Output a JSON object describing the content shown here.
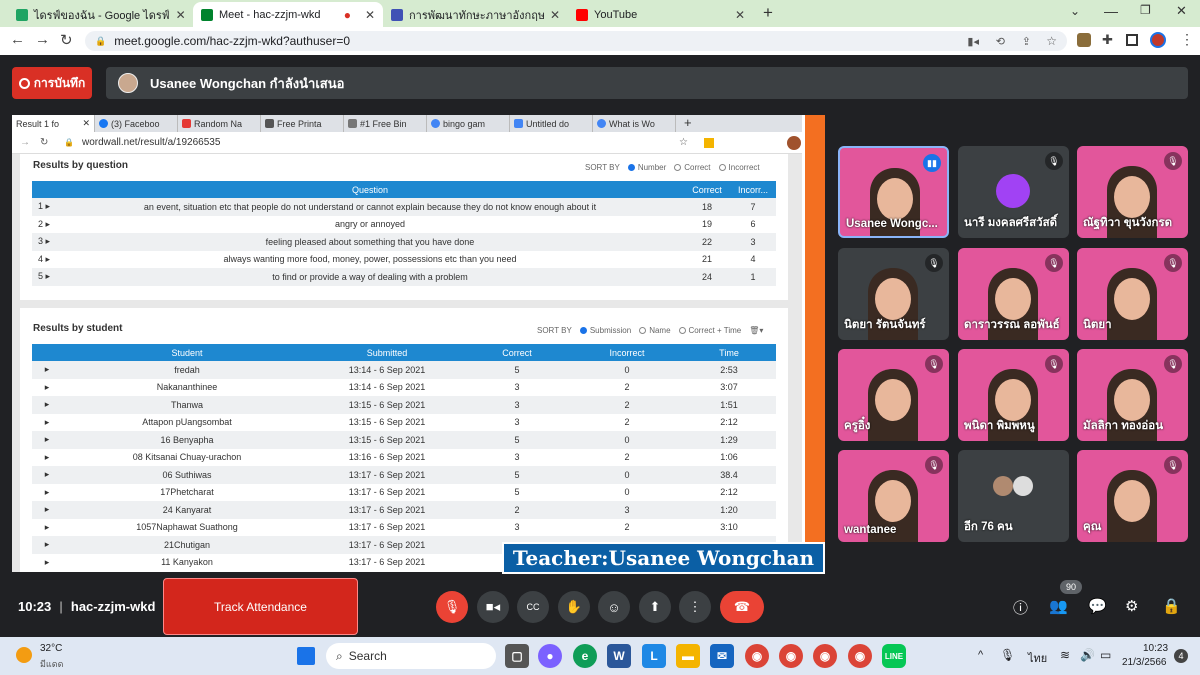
{
  "browser_tabs": [
    {
      "label": "ไดรฟ์ของฉัน - Google ไดรฟ์",
      "color": "#1fa463"
    },
    {
      "label": "Meet - hac-zzjm-wkd",
      "color": "#00832d"
    },
    {
      "label": "การพัฒนาทักษะภาษาอังกฤษ English",
      "color": "#3f51b5"
    },
    {
      "label": "YouTube",
      "color": "#ff0000"
    }
  ],
  "url": "meet.google.com/hac-zzjm-wkd?authuser=0",
  "meet": {
    "record_label": "การบันทึก",
    "presenter_text": "Usanee Wongchan กำลังนำเสนอ",
    "time": "10:23",
    "meeting_code": "hac-zzjm-wkd",
    "track_attendance": "Track Attendance",
    "people_count": "90"
  },
  "inner_browser": {
    "tabs": [
      "Result 1 fo",
      "(3) Faceboo",
      "Random Na",
      "Free Printa",
      "#1 Free Bin",
      "bingo gam",
      "Untitled do",
      "What is Wo"
    ],
    "url": "wordwall.net/result/a/19266535"
  },
  "results_by_question": {
    "title": "Results by question",
    "sort_by": "SORT BY",
    "sort_options": [
      "Number",
      "Correct",
      "Incorrect"
    ],
    "headers": [
      "Question",
      "Correct",
      "Incorr..."
    ],
    "rows": [
      {
        "num": "1",
        "question": "an event, situation etc that people do not understand or cannot explain because they do not know enough about it",
        "correct": "18",
        "incorrect": "7"
      },
      {
        "num": "2",
        "question": "angry or annoyed",
        "correct": "19",
        "incorrect": "6"
      },
      {
        "num": "3",
        "question": "feeling pleased about something that you have done",
        "correct": "22",
        "incorrect": "3"
      },
      {
        "num": "4",
        "question": "always wanting more food, money, power, possessions etc than you need",
        "correct": "21",
        "incorrect": "4"
      },
      {
        "num": "5",
        "question": "to find or provide a way of dealing with a problem",
        "correct": "24",
        "incorrect": "1"
      }
    ]
  },
  "results_by_student": {
    "title": "Results by student",
    "sort_by": "SORT BY",
    "sort_options": [
      "Submission",
      "Name",
      "Correct + Time"
    ],
    "headers": [
      "Student",
      "Submitted",
      "Correct",
      "Incorrect",
      "Time"
    ],
    "rows": [
      {
        "student": "fredah",
        "submitted": "13:14 - 6 Sep 2021",
        "correct": "5",
        "incorrect": "0",
        "time": "2:53"
      },
      {
        "student": "Nakananthinee",
        "submitted": "13:14 - 6 Sep 2021",
        "correct": "3",
        "incorrect": "2",
        "time": "3:07"
      },
      {
        "student": "Thanwa",
        "submitted": "13:15 - 6 Sep 2021",
        "correct": "3",
        "incorrect": "2",
        "time": "1:51"
      },
      {
        "student": "Attapon pUangsombat",
        "submitted": "13:15 - 6 Sep 2021",
        "correct": "3",
        "incorrect": "2",
        "time": "2:12"
      },
      {
        "student": "16 Benyapha",
        "submitted": "13:15 - 6 Sep 2021",
        "correct": "5",
        "incorrect": "0",
        "time": "1:29"
      },
      {
        "student": "08 Kitsanai Chuay-urachon",
        "submitted": "13:16 - 6 Sep 2021",
        "correct": "3",
        "incorrect": "2",
        "time": "1:06"
      },
      {
        "student": "06 Suthiwas",
        "submitted": "13:17 - 6 Sep 2021",
        "correct": "5",
        "incorrect": "0",
        "time": "38.4"
      },
      {
        "student": "17Phetcharat",
        "submitted": "13:17 - 6 Sep 2021",
        "correct": "5",
        "incorrect": "0",
        "time": "2:12"
      },
      {
        "student": "24 Kanyarat",
        "submitted": "13:17 - 6 Sep 2021",
        "correct": "2",
        "incorrect": "3",
        "time": "1:20"
      },
      {
        "student": "1057Naphawat Suathong",
        "submitted": "13:17 - 6 Sep 2021",
        "correct": "3",
        "incorrect": "2",
        "time": "3:10"
      },
      {
        "student": "21Chutigan",
        "submitted": "13:17 - 6 Sep 2021",
        "correct": "",
        "incorrect": "",
        "time": ""
      },
      {
        "student": "11 Kanyakon",
        "submitted": "13:17 - 6 Sep 2021",
        "correct": "",
        "incorrect": "",
        "time": ""
      }
    ]
  },
  "teacher_banner": "Teacher:Usanee Wongchan",
  "participants": [
    {
      "name": "Usanee Wongc...",
      "type": "pink"
    },
    {
      "name": "นารี มงคลศรีสวัสดิ์",
      "type": "avatar"
    },
    {
      "name": "ณัฐทิวา ขุนวังกรด",
      "type": "pink"
    },
    {
      "name": "นิตยา รัตนจันทร์",
      "type": "video"
    },
    {
      "name": "ดาราวรรณ ลอพันธ์",
      "type": "pink"
    },
    {
      "name": "นิตยา",
      "type": "pink"
    },
    {
      "name": "ครูอิ๋ง",
      "type": "pink"
    },
    {
      "name": "พนิดา พิมพหนู",
      "type": "pink"
    },
    {
      "name": "มัลลิกา ทองอ่อน",
      "type": "pink"
    },
    {
      "name": "wantanee",
      "type": "pink"
    },
    {
      "name": "อีก 76 คน",
      "type": "more"
    },
    {
      "name": "คุณ",
      "type": "pink"
    }
  ],
  "taskbar": {
    "temperature": "32°C",
    "weather": "มีแดด",
    "search": "Search",
    "language": "ไทย",
    "clock_time": "10:23",
    "clock_date": "21/3/2566",
    "notification_count": "4"
  }
}
